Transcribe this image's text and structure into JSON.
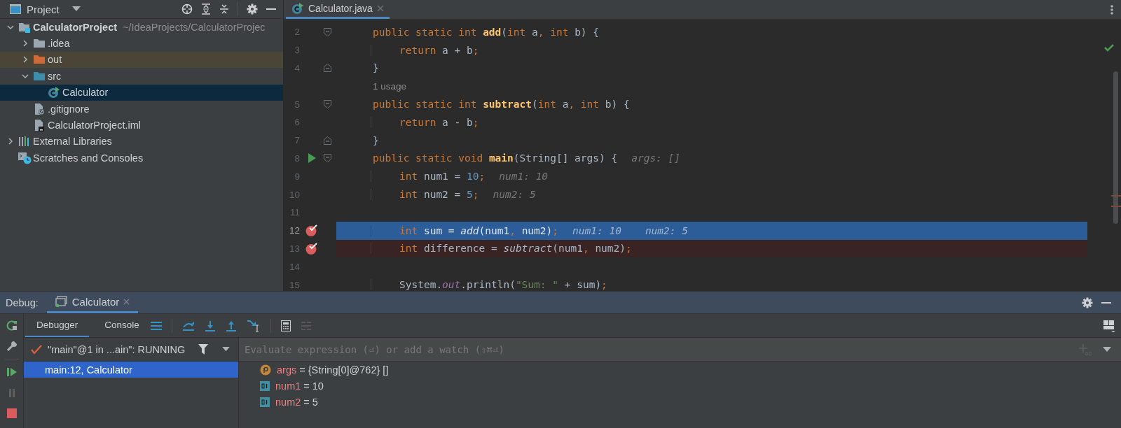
{
  "project_panel": {
    "title": "Project",
    "tree": [
      {
        "label": "CalculatorProject",
        "path": "~/IdeaProjects/CalculatorProjec",
        "kind": "module",
        "expanded": true,
        "selected": false,
        "children": [
          {
            "label": ".idea",
            "kind": "folder",
            "expanded": false,
            "selected": false
          },
          {
            "label": "out",
            "kind": "excluded",
            "expanded": false,
            "selected": false
          },
          {
            "label": "src",
            "kind": "source",
            "expanded": true,
            "selected": false,
            "children": [
              {
                "label": "Calculator",
                "kind": "class",
                "selected": true
              }
            ]
          },
          {
            "label": ".gitignore",
            "kind": "ignore",
            "selected": false
          },
          {
            "label": "CalculatorProject.iml",
            "kind": "iml",
            "selected": false
          }
        ]
      },
      {
        "label": "External Libraries",
        "kind": "libraries",
        "expanded": false,
        "selected": false
      },
      {
        "label": "Scratches and Consoles",
        "kind": "scratches",
        "selected": false
      }
    ]
  },
  "editor": {
    "tabs": [
      {
        "label": "Calculator.java",
        "selected": true
      }
    ],
    "lines": [
      {
        "kind": "code",
        "number": "2",
        "inner": false,
        "fold_start": true,
        "tokens": [
          {
            "kind": "keyword",
            "text": "public static int "
          },
          {
            "kind": "method",
            "text": "add"
          },
          {
            "kind": "plain",
            "text": "("
          },
          {
            "kind": "keyword",
            "text": "int"
          },
          {
            "kind": "plain",
            "text": " a"
          },
          {
            "kind": "keyword",
            "text": ", int"
          },
          {
            "kind": "plain",
            "text": " b) {"
          }
        ]
      },
      {
        "kind": "code",
        "number": "3",
        "inner": true,
        "tokens": [
          {
            "kind": "keyword",
            "text": "return"
          },
          {
            "kind": "plain",
            "text": " a + b"
          },
          {
            "kind": "keyword",
            "text": ";"
          }
        ]
      },
      {
        "kind": "code",
        "number": "4",
        "inner": false,
        "fold_end": true,
        "tokens": [
          {
            "kind": "plain",
            "text": "}"
          }
        ]
      },
      {
        "kind": "usage",
        "text": "1 usage"
      },
      {
        "kind": "code",
        "number": "5",
        "inner": false,
        "fold_start": true,
        "tokens": [
          {
            "kind": "keyword",
            "text": "public static int "
          },
          {
            "kind": "method",
            "text": "subtract"
          },
          {
            "kind": "plain",
            "text": "("
          },
          {
            "kind": "keyword",
            "text": "int"
          },
          {
            "kind": "plain",
            "text": " a"
          },
          {
            "kind": "keyword",
            "text": ", int"
          },
          {
            "kind": "plain",
            "text": " b) {"
          }
        ]
      },
      {
        "kind": "code",
        "number": "6",
        "inner": true,
        "tokens": [
          {
            "kind": "keyword",
            "text": "return"
          },
          {
            "kind": "plain",
            "text": " a - b"
          },
          {
            "kind": "keyword",
            "text": ";"
          }
        ]
      },
      {
        "kind": "code",
        "number": "7",
        "inner": false,
        "fold_end": true,
        "tokens": [
          {
            "kind": "plain",
            "text": "}"
          }
        ]
      },
      {
        "kind": "code",
        "number": "8",
        "inner": false,
        "fold_start": true,
        "run": true,
        "tokens": [
          {
            "kind": "keyword",
            "text": "public static void "
          },
          {
            "kind": "method",
            "text": "main"
          },
          {
            "kind": "plain",
            "text": "(String[] args) {"
          }
        ],
        "hints": [
          "args: []"
        ]
      },
      {
        "kind": "code",
        "number": "9",
        "inner": true,
        "tokens": [
          {
            "kind": "keyword",
            "text": "int"
          },
          {
            "kind": "plain",
            "text": " num1 = "
          },
          {
            "kind": "number",
            "text": "10"
          },
          {
            "kind": "keyword",
            "text": ";"
          }
        ],
        "hints": [
          "num1: 10"
        ]
      },
      {
        "kind": "code",
        "number": "10",
        "inner": true,
        "tokens": [
          {
            "kind": "keyword",
            "text": "int"
          },
          {
            "kind": "plain",
            "text": " num2 = "
          },
          {
            "kind": "number",
            "text": "5"
          },
          {
            "kind": "keyword",
            "text": ";"
          }
        ],
        "hints": [
          "num2: 5"
        ]
      },
      {
        "kind": "code",
        "number": "11"
      },
      {
        "kind": "code",
        "number": "12",
        "inner": true,
        "current": true,
        "breakpoint": true,
        "tokens": [
          {
            "kind": "keyword",
            "text": "int"
          },
          {
            "kind": "plain",
            "text": " sum = "
          },
          {
            "kind": "call",
            "text": "add"
          },
          {
            "kind": "plain",
            "text": "(num1"
          },
          {
            "kind": "keyword",
            "text": ","
          },
          {
            "kind": "plain",
            "text": " num2)"
          },
          {
            "kind": "keyword",
            "text": ";"
          }
        ],
        "hints": [
          "num1: 10",
          "num2: 5"
        ]
      },
      {
        "kind": "code",
        "number": "13",
        "inner": true,
        "current": false,
        "breakpoint": true,
        "tokens": [
          {
            "kind": "keyword",
            "text": "int"
          },
          {
            "kind": "plain",
            "text": " difference = "
          },
          {
            "kind": "call",
            "text": "subtract"
          },
          {
            "kind": "plain",
            "text": "(num1"
          },
          {
            "kind": "keyword",
            "text": ","
          },
          {
            "kind": "plain",
            "text": " num2)"
          },
          {
            "kind": "keyword",
            "text": ";"
          }
        ]
      },
      {
        "kind": "code",
        "number": "14"
      },
      {
        "kind": "code",
        "number": "15",
        "inner": true,
        "tokens": [
          {
            "kind": "plain",
            "text": "System."
          },
          {
            "kind": "field",
            "text": "out"
          },
          {
            "kind": "plain",
            "text": ".println("
          },
          {
            "kind": "string",
            "text": "\"Sum: \""
          },
          {
            "kind": "plain",
            "text": " + sum)"
          },
          {
            "kind": "keyword",
            "text": ";"
          }
        ]
      }
    ]
  },
  "debug": {
    "title": "Debug:",
    "sessions": [
      {
        "label": "Calculator",
        "selected": true
      }
    ],
    "tabs": [
      {
        "label": "Debugger",
        "selected": true
      },
      {
        "label": "Console",
        "selected": false
      }
    ],
    "thread": "\"main\"@1 in ...ain\": RUNNING",
    "frames": [
      {
        "label": "main:12, Calculator",
        "selected": true
      }
    ],
    "watch_placeholder": "Evaluate expression (⏎) or add a watch (⇧⌘⏎)",
    "variables": [
      {
        "kind": "param",
        "name": "args",
        "op": "=",
        "value": "{String[0]@762} []"
      },
      {
        "kind": "local",
        "name": "num1",
        "op": "=",
        "value": "10"
      },
      {
        "kind": "local",
        "name": "num2",
        "op": "=",
        "value": "5"
      }
    ]
  }
}
